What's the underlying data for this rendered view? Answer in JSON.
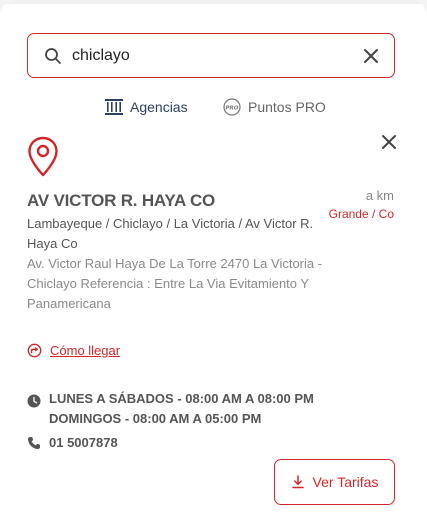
{
  "search": {
    "value": "chiclayo",
    "placeholder": ""
  },
  "tabs": [
    {
      "label": "Agencias",
      "icon": "bank-icon",
      "active": true
    },
    {
      "label": "Puntos PRO",
      "icon": "pro-badge-icon",
      "active": false
    }
  ],
  "agency": {
    "name": "AV VICTOR R. HAYA CO",
    "distance": "a km",
    "badge": "Grande / Co",
    "location": "Lambayeque / Chiclayo / La Victoria / Av Victor R. Haya Co",
    "address": "Av. Victor Raul Haya De La Torre 2470 La Victoria - Chiclayo Referencia : Entre La Via Evitamiento Y Panamericana",
    "directions_label": "Cómo llegar",
    "hours": [
      "LUNES A SÁBADOS - 08:00 AM A 08:00 PM",
      "DOMINGOS - 08:00 AM A 05:00 PM"
    ],
    "phone": "01 5007878",
    "rates_button": "Ver Tarifas"
  },
  "colors": {
    "accent": "#d1272b",
    "navy": "#2c3e63",
    "text": "#555555",
    "muted": "#8a8a8a"
  }
}
